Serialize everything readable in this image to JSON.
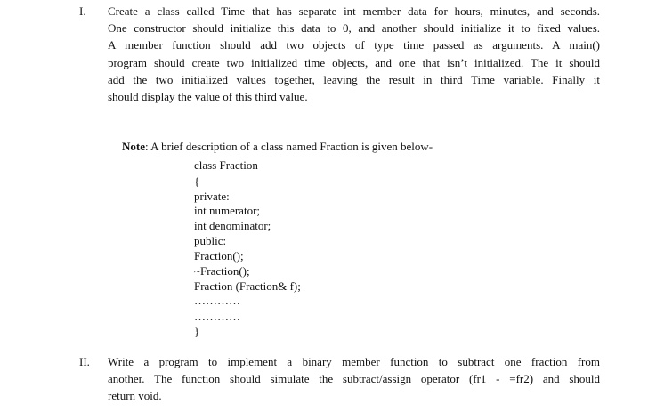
{
  "question1": {
    "numeral": "I.",
    "lines": [
      "Create a class called Time that has separate int member data for hours, minutes, and seconds.",
      "One constructor should initialize this data to 0, and another should initialize it to fixed values.",
      "A member function should add two objects of type time passed as arguments. A main()",
      "program should create two initialized time objects, and one that isn’t initialized. The it should",
      "add the two initialized values together, leaving the result in third Time variable. Finally it",
      "should display the value of this third value."
    ]
  },
  "note": {
    "label": "Note",
    "text": ": A brief description of a class named Fraction is given below-"
  },
  "code_lines": [
    "class Fraction",
    "{",
    "private:",
    "int numerator;",
    "int denominator;",
    "public:",
    "Fraction();",
    "~Fraction();",
    "Fraction (Fraction& f);",
    "…………",
    "…………",
    "}"
  ],
  "question2": {
    "numeral": "II.",
    "lines": [
      "Write a program to implement a binary member function to subtract one fraction from",
      "another. The function should simulate the subtract/assign operator (fr1 - =fr2) and should",
      "return void."
    ]
  }
}
